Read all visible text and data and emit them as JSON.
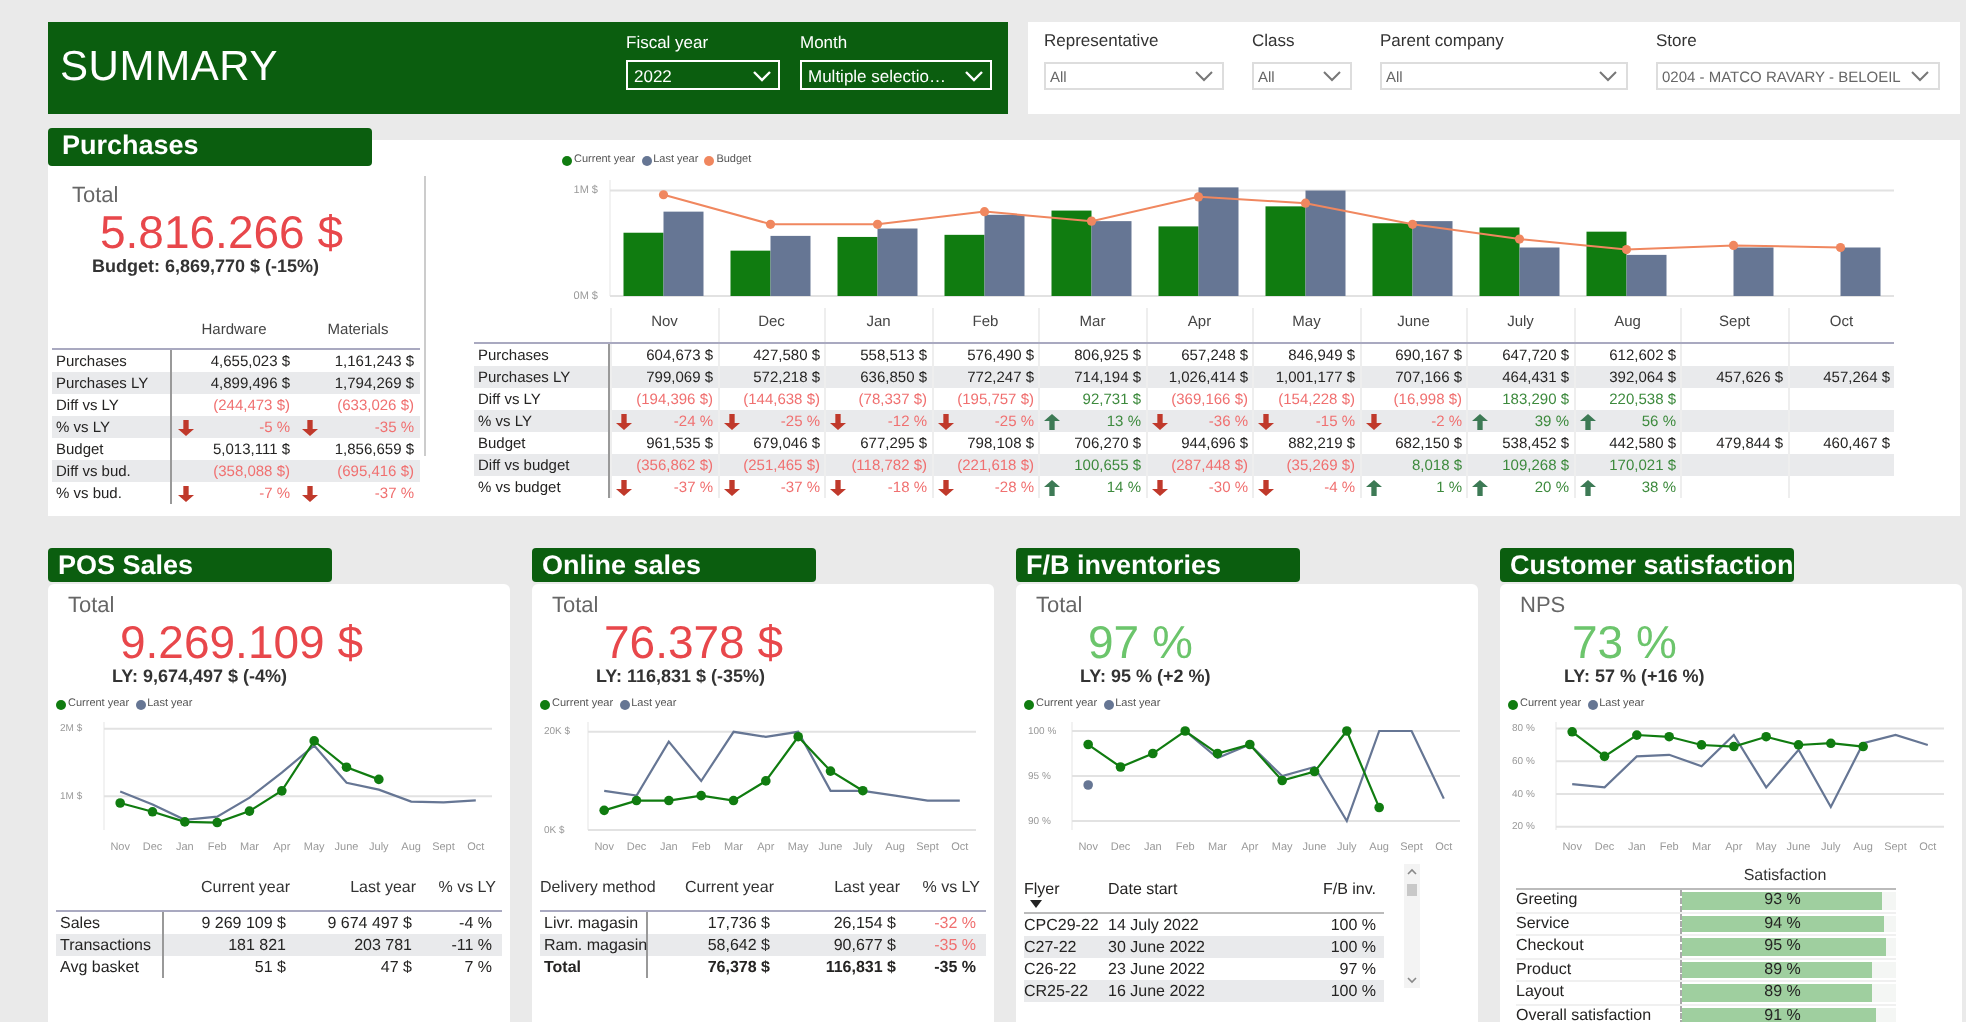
{
  "header": {
    "title": "SUMMARY",
    "filters": [
      {
        "label": "Fiscal year",
        "value": "2022"
      },
      {
        "label": "Month",
        "value": "Multiple selectio…"
      }
    ]
  },
  "filters": [
    {
      "label": "Representative",
      "value": "All"
    },
    {
      "label": "Class",
      "value": "All"
    },
    {
      "label": "Parent company",
      "value": "All"
    },
    {
      "label": "Store",
      "value": "0204 - MATCO RAVARY - BELOEIL"
    }
  ],
  "purchases": {
    "title": "Purchases",
    "total_label": "Total",
    "total": "5.816.266 $",
    "negative": true,
    "comparison": "Budget: 6,869,770 $ (-15%)",
    "category_table": {
      "columns": [
        "Hardware",
        "Materials"
      ],
      "rows": [
        {
          "label": "Purchases",
          "kind": "value",
          "cells": [
            "4,655,023 $",
            "1,161,243 $"
          ]
        },
        {
          "label": "Purchases LY",
          "kind": "value",
          "cells": [
            "4,899,496 $",
            "1,794,269 $"
          ]
        },
        {
          "label": "Diff vs LY",
          "kind": "diff",
          "cells": [
            {
              "text": "(244,473 $)",
              "negative": true
            },
            {
              "text": "(633,026 $)",
              "negative": true
            }
          ]
        },
        {
          "label": "% vs LY",
          "kind": "pct",
          "cells": [
            {
              "text": "-5 %",
              "negative": true
            },
            {
              "text": "-35 %",
              "negative": true
            }
          ]
        },
        {
          "label": "Budget",
          "kind": "value",
          "cells": [
            "5,013,111 $",
            "1,856,659 $"
          ]
        },
        {
          "label": "Diff vs bud.",
          "kind": "diff",
          "cells": [
            {
              "text": "(358,088 $)",
              "negative": true
            },
            {
              "text": "(695,416 $)",
              "negative": true
            }
          ]
        },
        {
          "label": "% vs bud.",
          "kind": "pct",
          "cells": [
            {
              "text": "-7 %",
              "negative": true
            },
            {
              "text": "-37 %",
              "negative": true
            }
          ]
        }
      ]
    },
    "chart_data": {
      "type": "bar",
      "categories": [
        "Nov",
        "Dec",
        "Jan",
        "Feb",
        "Mar",
        "Apr",
        "May",
        "June",
        "July",
        "Aug",
        "Sept",
        "Oct"
      ],
      "ylim": [
        0,
        1.1
      ],
      "yticks": [
        {
          "value": 0,
          "label": "0M $"
        },
        {
          "value": 1,
          "label": "1M $"
        }
      ],
      "grid": true,
      "series": [
        {
          "name": "Current year",
          "type": "bar",
          "color": "#107c10",
          "values": [
            0.6,
            0.43,
            0.56,
            0.58,
            0.81,
            0.66,
            0.85,
            0.69,
            0.65,
            0.61,
            null,
            null
          ]
        },
        {
          "name": "Last year",
          "type": "bar",
          "color": "#667694",
          "values": [
            0.8,
            0.57,
            0.64,
            0.77,
            0.71,
            1.03,
            1.0,
            0.71,
            0.46,
            0.39,
            0.46,
            0.46
          ]
        },
        {
          "name": "Budget",
          "type": "line",
          "marker": true,
          "color": "#f0875f",
          "values": [
            0.96,
            0.68,
            0.68,
            0.8,
            0.71,
            0.94,
            0.88,
            0.68,
            0.54,
            0.44,
            0.48,
            0.46
          ]
        }
      ]
    },
    "monthly_table": {
      "rows": [
        {
          "label": "Purchases",
          "kind": "value",
          "cells": [
            "604,673 $",
            "427,580 $",
            "558,513 $",
            "576,490 $",
            "806,925 $",
            "657,248 $",
            "846,949 $",
            "690,167 $",
            "647,720 $",
            "612,602 $",
            null,
            null
          ]
        },
        {
          "label": "Purchases LY",
          "kind": "value",
          "cells": [
            "799,069 $",
            "572,218 $",
            "636,850 $",
            "772,247 $",
            "714,194 $",
            "1,026,414 $",
            "1,001,177 $",
            "707,166 $",
            "464,431 $",
            "392,064 $",
            "457,626 $",
            "457,264 $"
          ]
        },
        {
          "label": "Diff vs LY",
          "kind": "diff",
          "cells": [
            {
              "text": "(194,396 $)",
              "negative": true
            },
            {
              "text": "(144,638 $)",
              "negative": true
            },
            {
              "text": "(78,337 $)",
              "negative": true
            },
            {
              "text": "(195,757 $)",
              "negative": true
            },
            {
              "text": "92,731 $",
              "negative": false
            },
            {
              "text": "(369,166 $)",
              "negative": true
            },
            {
              "text": "(154,228 $)",
              "negative": true
            },
            {
              "text": "(16,998 $)",
              "negative": true
            },
            {
              "text": "183,290 $",
              "negative": false
            },
            {
              "text": "220,538 $",
              "negative": false
            },
            null,
            null
          ]
        },
        {
          "label": "% vs LY",
          "kind": "pct",
          "cells": [
            {
              "text": "-24 %",
              "negative": true
            },
            {
              "text": "-25 %",
              "negative": true
            },
            {
              "text": "-12 %",
              "negative": true
            },
            {
              "text": "-25 %",
              "negative": true
            },
            {
              "text": "13 %",
              "negative": false
            },
            {
              "text": "-36 %",
              "negative": true
            },
            {
              "text": "-15 %",
              "negative": true
            },
            {
              "text": "-2 %",
              "negative": true
            },
            {
              "text": "39 %",
              "negative": false
            },
            {
              "text": "56 %",
              "negative": false
            },
            null,
            null
          ]
        },
        {
          "label": "Budget",
          "kind": "value",
          "cells": [
            "961,535 $",
            "679,046 $",
            "677,295 $",
            "798,108 $",
            "706,270 $",
            "944,696 $",
            "882,219 $",
            "682,150 $",
            "538,452 $",
            "442,580 $",
            "479,844 $",
            "460,467 $"
          ]
        },
        {
          "label": "Diff vs budget",
          "kind": "diff",
          "cells": [
            {
              "text": "(356,862 $)",
              "negative": true
            },
            {
              "text": "(251,465 $)",
              "negative": true
            },
            {
              "text": "(118,782 $)",
              "negative": true
            },
            {
              "text": "(221,618 $)",
              "negative": true
            },
            {
              "text": "100,655 $",
              "negative": false
            },
            {
              "text": "(287,448 $)",
              "negative": true
            },
            {
              "text": "(35,269 $)",
              "negative": true
            },
            {
              "text": "8,018 $",
              "negative": false
            },
            {
              "text": "109,268 $",
              "negative": false
            },
            {
              "text": "170,021 $",
              "negative": false
            },
            null,
            null
          ]
        },
        {
          "label": "% vs budget",
          "kind": "pct",
          "cells": [
            {
              "text": "-37 %",
              "negative": true
            },
            {
              "text": "-37 %",
              "negative": true
            },
            {
              "text": "-18 %",
              "negative": true
            },
            {
              "text": "-28 %",
              "negative": true
            },
            {
              "text": "14 %",
              "negative": false
            },
            {
              "text": "-30 %",
              "negative": true
            },
            {
              "text": "-4 %",
              "negative": true
            },
            {
              "text": "1 %",
              "negative": false
            },
            {
              "text": "20 %",
              "negative": false
            },
            {
              "text": "38 %",
              "negative": false
            },
            null,
            null
          ]
        }
      ]
    }
  },
  "cards": [
    {
      "title": "POS Sales",
      "total_label": "Total",
      "total": "9.269.109 $",
      "negative": true,
      "comparison": "LY: 9,674,497 $ (-4%)",
      "chart_data": {
        "type": "line",
        "categories": [
          "Nov",
          "Dec",
          "Jan",
          "Feb",
          "Mar",
          "Apr",
          "May",
          "June",
          "July",
          "Aug",
          "Sept",
          "Oct"
        ],
        "ylim": [
          0.5,
          2.1
        ],
        "yticks": [
          {
            "value": 1,
            "label": "1M $"
          },
          {
            "value": 2,
            "label": "2M $"
          }
        ],
        "grid": true,
        "series": [
          {
            "name": "Current year",
            "color": "#107c10",
            "marker": true,
            "values": [
              0.9,
              0.77,
              0.62,
              0.61,
              0.78,
              1.08,
              1.82,
              1.43,
              1.25,
              null,
              null,
              null
            ]
          },
          {
            "name": "Last year",
            "color": "#667694",
            "values": [
              1.07,
              0.88,
              0.65,
              0.7,
              0.98,
              1.35,
              1.75,
              1.2,
              1.1,
              0.92,
              0.91,
              0.94
            ]
          }
        ]
      },
      "table": {
        "kind": "metrics",
        "columns": [
          "Current year",
          "Last year",
          "% vs LY"
        ],
        "rows": [
          {
            "label": "Sales",
            "total": false,
            "cells": [
              "9 269 109 $",
              "9 674 497 $",
              "-4 %"
            ]
          },
          {
            "label": "Transactions",
            "total": false,
            "cells": [
              "181 821",
              "203 781",
              "-11 %"
            ]
          },
          {
            "label": "Avg basket",
            "total": false,
            "cells": [
              "51 $",
              "47 $",
              "7 %"
            ]
          }
        ]
      }
    },
    {
      "title": "Online sales",
      "total_label": "Total",
      "total": "76.378 $",
      "negative": true,
      "comparison": "LY: 116,831 $ (-35%)",
      "chart_data": {
        "type": "line",
        "categories": [
          "Nov",
          "Dec",
          "Jan",
          "Feb",
          "Mar",
          "Apr",
          "May",
          "June",
          "July",
          "Aug",
          "Sept",
          "Oct"
        ],
        "ylim": [
          0,
          22
        ],
        "yticks": [
          {
            "value": 0,
            "label": "0K $"
          },
          {
            "value": 20,
            "label": "20K $"
          }
        ],
        "grid": true,
        "series": [
          {
            "name": "Current year",
            "color": "#107c10",
            "marker": true,
            "values": [
              4,
              6,
              6,
              7,
              6,
              10,
              19,
              12,
              8,
              null,
              null,
              null
            ]
          },
          {
            "name": "Last year",
            "color": "#667694",
            "values": [
              8,
              7,
              18,
              10,
              20,
              19,
              20,
              8,
              8,
              7,
              6,
              6
            ]
          }
        ]
      },
      "table": {
        "kind": "metrics",
        "label_heading": "Delivery method",
        "columns": [
          "Current year",
          "Last year",
          "% vs LY"
        ],
        "rows": [
          {
            "label": "Livr. magasin",
            "total": false,
            "cells": [
              "17,736 $",
              "26,154 $",
              {
                "text": "-32 %",
                "negative": true
              }
            ]
          },
          {
            "label": "Ram. magasin",
            "total": false,
            "cells": [
              "58,642 $",
              "90,677 $",
              {
                "text": "-35 %",
                "negative": true
              }
            ]
          },
          {
            "label": "Total",
            "total": true,
            "cells": [
              "76,378 $",
              "116,831 $",
              "-35 %"
            ]
          }
        ]
      }
    },
    {
      "title": "F/B inventories",
      "total_label": "Total",
      "total": "97 %",
      "negative": false,
      "comparison": "LY: 95 % (+2 %)",
      "chart_data": {
        "type": "line",
        "categories": [
          "Nov",
          "Dec",
          "Jan",
          "Feb",
          "Mar",
          "Apr",
          "May",
          "June",
          "July",
          "Aug",
          "Sept",
          "Oct"
        ],
        "ylim": [
          89,
          101
        ],
        "yticks": [
          {
            "value": 90,
            "label": "90 %"
          },
          {
            "value": 95,
            "label": "95 %"
          },
          {
            "value": 100,
            "label": "100 %"
          }
        ],
        "grid": true,
        "series": [
          {
            "name": "Current year",
            "color": "#107c10",
            "marker": true,
            "values": [
              98.5,
              96,
              97.5,
              100,
              97.5,
              98.5,
              94.5,
              95.5,
              100,
              91.5,
              null,
              null
            ]
          },
          {
            "name": "Last year",
            "color": "#667694",
            "values": [
              94,
              null,
              null,
              100,
              97,
              98.5,
              95,
              96,
              90,
              100,
              100,
              92.5
            ]
          }
        ]
      },
      "table": {
        "kind": "flyers",
        "columns": [
          "Flyer",
          "Date start",
          "F/B inv."
        ],
        "rows": [
          {
            "cells": [
              "CPC29-22",
              "14 July 2022",
              "100 %"
            ]
          },
          {
            "cells": [
              "C27-22",
              "30 June 2022",
              "100 %"
            ]
          },
          {
            "cells": [
              "C26-22",
              "23 June 2022",
              "97 %"
            ]
          },
          {
            "cells": [
              "CR25-22",
              "16 June 2022",
              "100 %"
            ]
          }
        ]
      }
    },
    {
      "title": "Customer satisfaction",
      "total_label": "NPS",
      "total": "73 %",
      "negative": false,
      "comparison": "LY: 57 % (+16 %)",
      "chart_data": {
        "type": "line",
        "categories": [
          "Nov",
          "Dec",
          "Jan",
          "Feb",
          "Mar",
          "Apr",
          "May",
          "June",
          "July",
          "Aug",
          "Sept",
          "Oct"
        ],
        "ylim": [
          18,
          84
        ],
        "yticks": [
          {
            "value": 20,
            "label": "20 %"
          },
          {
            "value": 40,
            "label": "40 %"
          },
          {
            "value": 60,
            "label": "60 %"
          },
          {
            "value": 80,
            "label": "80 %"
          }
        ],
        "grid": true,
        "series": [
          {
            "name": "Current year",
            "color": "#107c10",
            "marker": true,
            "values": [
              78,
              63,
              76,
              75,
              70,
              69,
              75,
              70,
              71,
              69,
              null,
              null
            ]
          },
          {
            "name": "Last year",
            "color": "#667694",
            "values": [
              46,
              44,
              63,
              64,
              57,
              76,
              44,
              67,
              32,
              71,
              76,
              70
            ]
          }
        ]
      },
      "table": {
        "kind": "bars",
        "title": "Satisfaction",
        "rows": [
          {
            "label": "Greeting",
            "value": "93 %",
            "level": 0.93
          },
          {
            "label": "Service",
            "value": "94 %",
            "level": 0.94
          },
          {
            "label": "Checkout",
            "value": "95 %",
            "level": 0.95
          },
          {
            "label": "Product",
            "value": "89 %",
            "level": 0.89
          },
          {
            "label": "Layout",
            "value": "89 %",
            "level": 0.89
          },
          {
            "label": "Overall satisfaction",
            "value": "91 %",
            "level": 0.91
          }
        ]
      }
    }
  ]
}
